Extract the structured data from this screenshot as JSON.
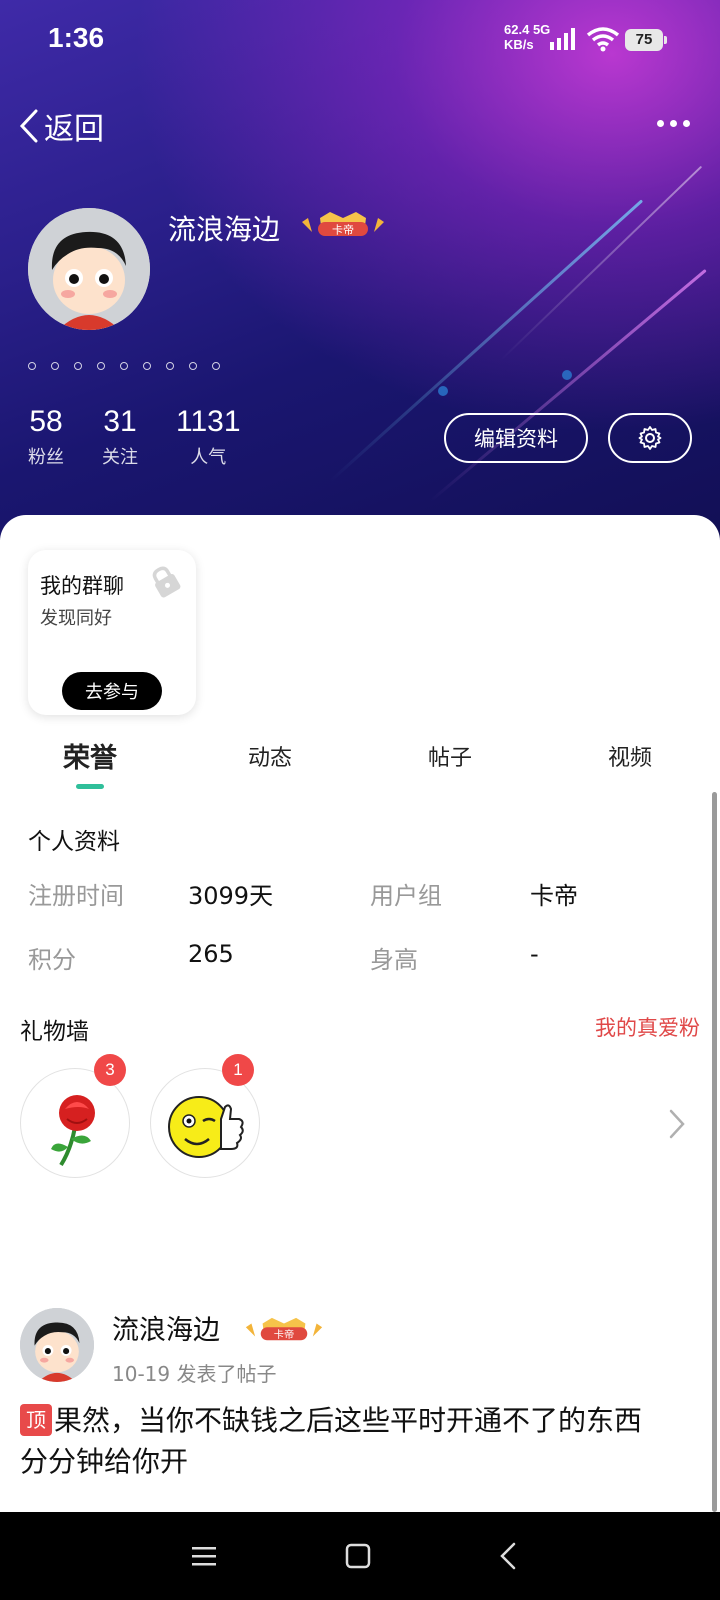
{
  "status_bar": {
    "time": "1:36",
    "net_speed": "62.4",
    "net_unit": "KB/s",
    "net_type": "5G",
    "battery": "75"
  },
  "nav": {
    "back_label": "返回"
  },
  "profile": {
    "username": "流浪海边",
    "badge_text": "卡帝",
    "stats": [
      {
        "value": "58",
        "label": "粉丝"
      },
      {
        "value": "31",
        "label": "关注"
      },
      {
        "value": "1131",
        "label": "人气"
      }
    ],
    "edit_label": "编辑资料"
  },
  "group_card": {
    "title": "我的群聊",
    "subtitle": "发现同好",
    "join_label": "去参与"
  },
  "tabs": [
    {
      "label": "荣誉",
      "active": true
    },
    {
      "label": "动态",
      "active": false
    },
    {
      "label": "帖子",
      "active": false
    },
    {
      "label": "视频",
      "active": false
    }
  ],
  "personal_info": {
    "title": "个人资料",
    "reg_time_key": "注册时间",
    "reg_time_val": "3099天",
    "group_key": "用户组",
    "group_val": "卡帝",
    "points_key": "积分",
    "points_val": "265",
    "height_key": "身高",
    "height_val": "-"
  },
  "gift_wall": {
    "title": "礼物墙",
    "fans_link": "我的真爱粉",
    "gifts": [
      {
        "icon": "rose-icon",
        "count": "3"
      },
      {
        "icon": "thumbs-up-smiley-icon",
        "count": "1"
      }
    ]
  },
  "post": {
    "author": "流浪海边",
    "badge_text": "卡帝",
    "meta": "10-19 发表了帖子",
    "pin_tag": "顶",
    "line1": "果然，当你不缺钱之后这些平时开通不了的东西",
    "line2": "分分钟给你开"
  },
  "colors": {
    "accent": "#2fbf9a",
    "red": "#e04848",
    "hero_dark": "#1a1670",
    "hero_pink": "#d23cdc"
  }
}
